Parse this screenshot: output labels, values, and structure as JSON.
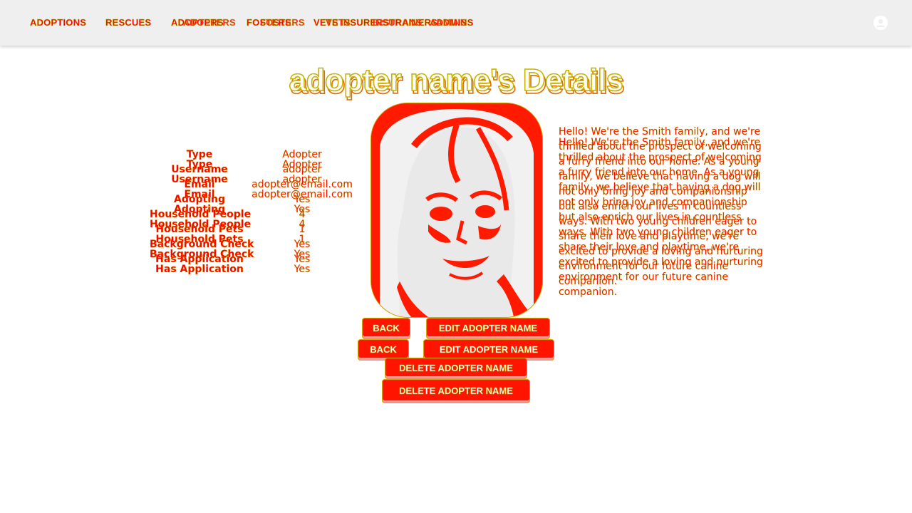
{
  "nav": {
    "brand": "ADOPTIONS",
    "links": [
      "RESCUES",
      "ADOPTERS",
      "FOSTERS",
      "VETS",
      "INSURERS",
      "TRAINERS",
      "ADMINS"
    ],
    "ghost_links": [
      "ADOPTERS",
      "FOSTERS",
      "VETS",
      "INSURANS",
      "ADMINS"
    ],
    "colors": {
      "bar": "#efefef",
      "text": "#ff0000",
      "outline": "#c8b400"
    }
  },
  "page_title": "adopter name's Details",
  "details": [
    {
      "label": "Type",
      "value": "Adopter"
    },
    {
      "label": "Username",
      "value": "adopter"
    },
    {
      "label": "Email",
      "value": "adopter@email.com"
    },
    {
      "label": "Adopting",
      "value": "Yes"
    },
    {
      "label": "Household People",
      "value": "4"
    },
    {
      "label": "Household Pets",
      "value": "1"
    },
    {
      "label": "Background Check",
      "value": "Yes"
    },
    {
      "label": "Has Application",
      "value": "Yes"
    }
  ],
  "photo": {
    "description_icon": "profile-photo",
    "accent": "#ff1a00"
  },
  "bio": "Hello! We're the Smith family, and we're thrilled about the prospect of welcoming a furry friend into our home. As a young family, we believe that having a dog will not only bring joy and companionship but also enrich our lives in countless ways. With two young children eager to share their love and playtime, we're excited to provide a loving and nurturing environment for our future canine companion.",
  "buttons": {
    "back": "BACK",
    "edit": "EDIT ADOPTER NAME",
    "delete": "DELETE ADOPTER NAME"
  },
  "icons": {
    "account": "account-circle-icon"
  }
}
